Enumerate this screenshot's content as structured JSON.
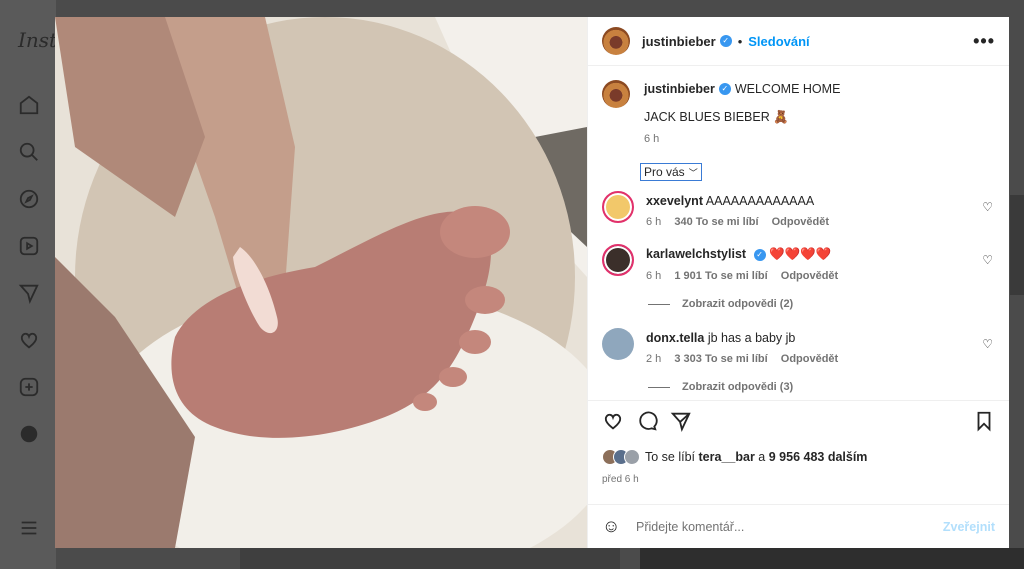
{
  "background": {
    "logo": "Inst",
    "nav_icons": [
      "home-icon",
      "search-icon",
      "explore-icon",
      "reels-icon",
      "messages-icon",
      "notifications-icon",
      "create-icon",
      "profile-icon",
      "menu-icon"
    ]
  },
  "post": {
    "author": "justinbieber",
    "follow_label": "Sledování",
    "dot": "•",
    "more": "•••",
    "caption_line1": "WELCOME HOME",
    "caption_line2": "JACK BLUES BIEBER 🧸",
    "caption_time": "6 h",
    "filter_label": "Pro vás",
    "comments": [
      {
        "user": "xxevelynt",
        "text": "AAAAAAAAAAAAA",
        "time": "6 h",
        "likes": "340 To se mi líbí",
        "reply": "Odpovědět",
        "view_replies": "",
        "avatar_color": "#f2c86a"
      },
      {
        "user": "karlawelchstylist",
        "verified": true,
        "text": "❤️❤️❤️❤️",
        "time": "6 h",
        "likes": "1 901 To se mi líbí",
        "reply": "Odpovědět",
        "view_replies": "Zobrazit odpovědi (2)",
        "avatar_color": "#3b2f2a"
      },
      {
        "user": "donx.tella",
        "text": "jb has a baby jb",
        "time": "2 h",
        "likes": "3 303 To se mi líbí",
        "reply": "Odpovědět",
        "view_replies": "Zobrazit odpovědi (3)",
        "avatar_color": "#8fa7bd"
      }
    ],
    "likes_prefix": "To se líbí",
    "likes_user": "tera__bar",
    "likes_and": "a",
    "likes_count": "9 956 483 dalším",
    "posted_ago": "před 6 h",
    "comment_placeholder": "Přidejte komentář...",
    "post_button": "Zveřejnit"
  },
  "colors": {
    "accent": "#0095f6",
    "verified": "#3897f0",
    "muted": "#737373"
  }
}
